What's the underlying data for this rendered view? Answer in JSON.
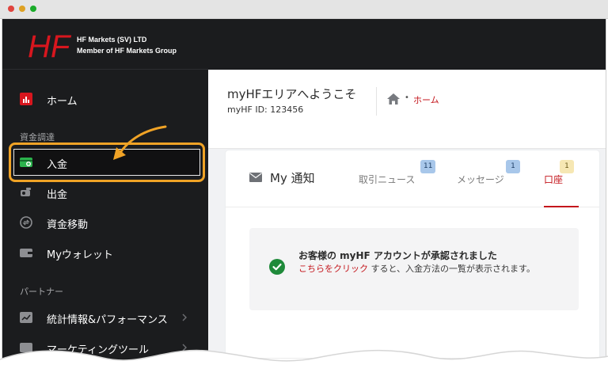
{
  "window": {
    "controls": [
      "close",
      "minimize",
      "maximize"
    ]
  },
  "brand": {
    "logo_text": "HF",
    "line1": "HF Markets (SV) LTD",
    "line2": "Member of HF Markets Group"
  },
  "sidebar": {
    "home": {
      "label": "ホーム",
      "icon": "chart-icon"
    },
    "section_funding": "資金調達",
    "items": [
      {
        "label": "入金",
        "icon": "deposit-icon",
        "highlighted": true
      },
      {
        "label": "出金",
        "icon": "withdraw-icon"
      },
      {
        "label": "資金移動",
        "icon": "transfer-icon"
      },
      {
        "label": "Myウォレット",
        "icon": "wallet-icon"
      }
    ],
    "section_partner": "パートナー",
    "partner_items": [
      {
        "label": "統計情報&パフォーマンス",
        "icon": "stats-icon"
      },
      {
        "label": "マーケティングツール",
        "icon": "marketing-icon"
      }
    ]
  },
  "header": {
    "welcome": "myHFエリアへようこそ",
    "myhf_id_label": "myHF ID: 123456",
    "breadcrumb": {
      "separator": "•",
      "home": "ホーム"
    }
  },
  "card": {
    "title": "My 通知",
    "tabs": [
      {
        "label": "取引ニュース",
        "badge": "11",
        "active": false
      },
      {
        "label": "メッセージ",
        "badge": "1",
        "active": false
      },
      {
        "label": "口座",
        "badge": "1",
        "active": true
      }
    ],
    "notice": {
      "title": "お客様の myHF アカウントが承認されました",
      "link": "こちらをクリック",
      "body": " すると、入金方法の一覧が表示されます。"
    }
  },
  "colors": {
    "accent_red": "#c4161c",
    "highlight_orange": "#f0a326",
    "sidebar_bg": "#1b1c1e",
    "success_green": "#1f8a3a"
  }
}
